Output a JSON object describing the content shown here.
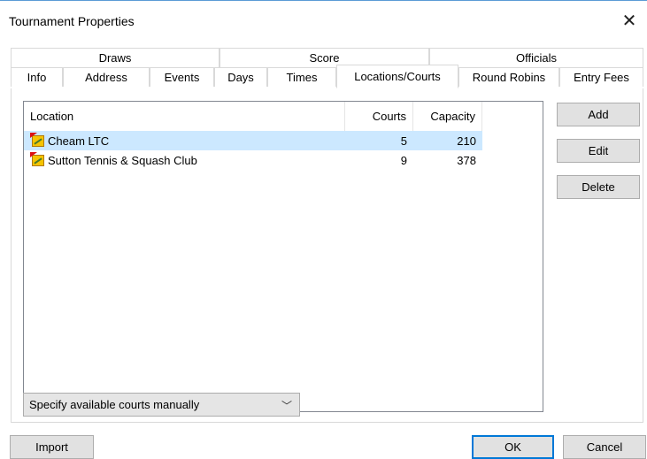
{
  "window": {
    "title": "Tournament Properties",
    "close_glyph": "✕"
  },
  "tabs": {
    "row1": [
      {
        "label": "Draws"
      },
      {
        "label": "Score"
      },
      {
        "label": "Officials"
      }
    ],
    "row2": [
      {
        "label": "Info"
      },
      {
        "label": "Address"
      },
      {
        "label": "Events"
      },
      {
        "label": "Days"
      },
      {
        "label": "Times"
      },
      {
        "label": "Locations/Courts",
        "active": true
      },
      {
        "label": "Round Robins"
      },
      {
        "label": "Entry Fees"
      }
    ]
  },
  "locations": {
    "columns": [
      "Location",
      "Courts",
      "Capacity"
    ],
    "rows": [
      {
        "name": "Cheam LTC",
        "courts": "5",
        "capacity": "210",
        "selected": true,
        "icon": "tennis-court-icon"
      },
      {
        "name": "Sutton Tennis & Squash Club",
        "courts": "9",
        "capacity": "378",
        "selected": false,
        "icon": "tennis-court-icon"
      }
    ]
  },
  "side_buttons": {
    "add": "Add",
    "edit": "Edit",
    "delete": "Delete"
  },
  "courts_mode": {
    "selected": "Specify available courts manually"
  },
  "footer": {
    "import": "Import",
    "ok": "OK",
    "cancel": "Cancel"
  },
  "colors": {
    "selection": "#cce8ff",
    "accent": "#0078d7"
  }
}
